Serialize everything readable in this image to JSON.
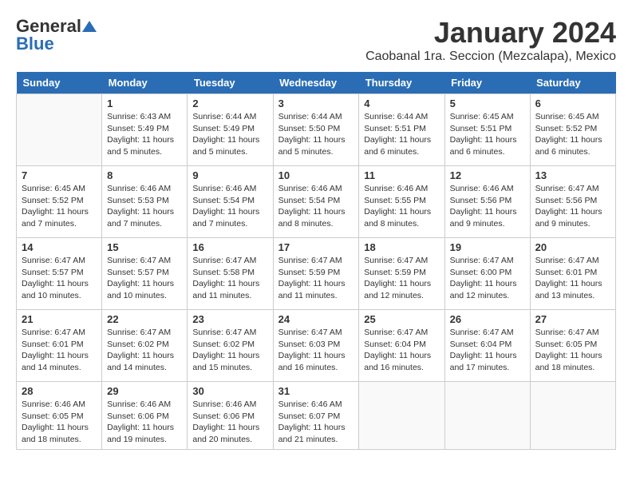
{
  "logo": {
    "general": "General",
    "blue": "Blue"
  },
  "title": "January 2024",
  "location": "Caobanal 1ra. Seccion (Mezcalapa), Mexico",
  "weekdays": [
    "Sunday",
    "Monday",
    "Tuesday",
    "Wednesday",
    "Thursday",
    "Friday",
    "Saturday"
  ],
  "weeks": [
    [
      {
        "day": "",
        "info": ""
      },
      {
        "day": "1",
        "info": "Sunrise: 6:43 AM\nSunset: 5:49 PM\nDaylight: 11 hours and 5 minutes."
      },
      {
        "day": "2",
        "info": "Sunrise: 6:44 AM\nSunset: 5:49 PM\nDaylight: 11 hours and 5 minutes."
      },
      {
        "day": "3",
        "info": "Sunrise: 6:44 AM\nSunset: 5:50 PM\nDaylight: 11 hours and 5 minutes."
      },
      {
        "day": "4",
        "info": "Sunrise: 6:44 AM\nSunset: 5:51 PM\nDaylight: 11 hours and 6 minutes."
      },
      {
        "day": "5",
        "info": "Sunrise: 6:45 AM\nSunset: 5:51 PM\nDaylight: 11 hours and 6 minutes."
      },
      {
        "day": "6",
        "info": "Sunrise: 6:45 AM\nSunset: 5:52 PM\nDaylight: 11 hours and 6 minutes."
      }
    ],
    [
      {
        "day": "7",
        "info": "Sunrise: 6:45 AM\nSunset: 5:52 PM\nDaylight: 11 hours and 7 minutes."
      },
      {
        "day": "8",
        "info": "Sunrise: 6:46 AM\nSunset: 5:53 PM\nDaylight: 11 hours and 7 minutes."
      },
      {
        "day": "9",
        "info": "Sunrise: 6:46 AM\nSunset: 5:54 PM\nDaylight: 11 hours and 7 minutes."
      },
      {
        "day": "10",
        "info": "Sunrise: 6:46 AM\nSunset: 5:54 PM\nDaylight: 11 hours and 8 minutes."
      },
      {
        "day": "11",
        "info": "Sunrise: 6:46 AM\nSunset: 5:55 PM\nDaylight: 11 hours and 8 minutes."
      },
      {
        "day": "12",
        "info": "Sunrise: 6:46 AM\nSunset: 5:56 PM\nDaylight: 11 hours and 9 minutes."
      },
      {
        "day": "13",
        "info": "Sunrise: 6:47 AM\nSunset: 5:56 PM\nDaylight: 11 hours and 9 minutes."
      }
    ],
    [
      {
        "day": "14",
        "info": "Sunrise: 6:47 AM\nSunset: 5:57 PM\nDaylight: 11 hours and 10 minutes."
      },
      {
        "day": "15",
        "info": "Sunrise: 6:47 AM\nSunset: 5:57 PM\nDaylight: 11 hours and 10 minutes."
      },
      {
        "day": "16",
        "info": "Sunrise: 6:47 AM\nSunset: 5:58 PM\nDaylight: 11 hours and 11 minutes."
      },
      {
        "day": "17",
        "info": "Sunrise: 6:47 AM\nSunset: 5:59 PM\nDaylight: 11 hours and 11 minutes."
      },
      {
        "day": "18",
        "info": "Sunrise: 6:47 AM\nSunset: 5:59 PM\nDaylight: 11 hours and 12 minutes."
      },
      {
        "day": "19",
        "info": "Sunrise: 6:47 AM\nSunset: 6:00 PM\nDaylight: 11 hours and 12 minutes."
      },
      {
        "day": "20",
        "info": "Sunrise: 6:47 AM\nSunset: 6:01 PM\nDaylight: 11 hours and 13 minutes."
      }
    ],
    [
      {
        "day": "21",
        "info": "Sunrise: 6:47 AM\nSunset: 6:01 PM\nDaylight: 11 hours and 14 minutes."
      },
      {
        "day": "22",
        "info": "Sunrise: 6:47 AM\nSunset: 6:02 PM\nDaylight: 11 hours and 14 minutes."
      },
      {
        "day": "23",
        "info": "Sunrise: 6:47 AM\nSunset: 6:02 PM\nDaylight: 11 hours and 15 minutes."
      },
      {
        "day": "24",
        "info": "Sunrise: 6:47 AM\nSunset: 6:03 PM\nDaylight: 11 hours and 16 minutes."
      },
      {
        "day": "25",
        "info": "Sunrise: 6:47 AM\nSunset: 6:04 PM\nDaylight: 11 hours and 16 minutes."
      },
      {
        "day": "26",
        "info": "Sunrise: 6:47 AM\nSunset: 6:04 PM\nDaylight: 11 hours and 17 minutes."
      },
      {
        "day": "27",
        "info": "Sunrise: 6:47 AM\nSunset: 6:05 PM\nDaylight: 11 hours and 18 minutes."
      }
    ],
    [
      {
        "day": "28",
        "info": "Sunrise: 6:46 AM\nSunset: 6:05 PM\nDaylight: 11 hours and 18 minutes."
      },
      {
        "day": "29",
        "info": "Sunrise: 6:46 AM\nSunset: 6:06 PM\nDaylight: 11 hours and 19 minutes."
      },
      {
        "day": "30",
        "info": "Sunrise: 6:46 AM\nSunset: 6:06 PM\nDaylight: 11 hours and 20 minutes."
      },
      {
        "day": "31",
        "info": "Sunrise: 6:46 AM\nSunset: 6:07 PM\nDaylight: 11 hours and 21 minutes."
      },
      {
        "day": "",
        "info": ""
      },
      {
        "day": "",
        "info": ""
      },
      {
        "day": "",
        "info": ""
      }
    ]
  ]
}
